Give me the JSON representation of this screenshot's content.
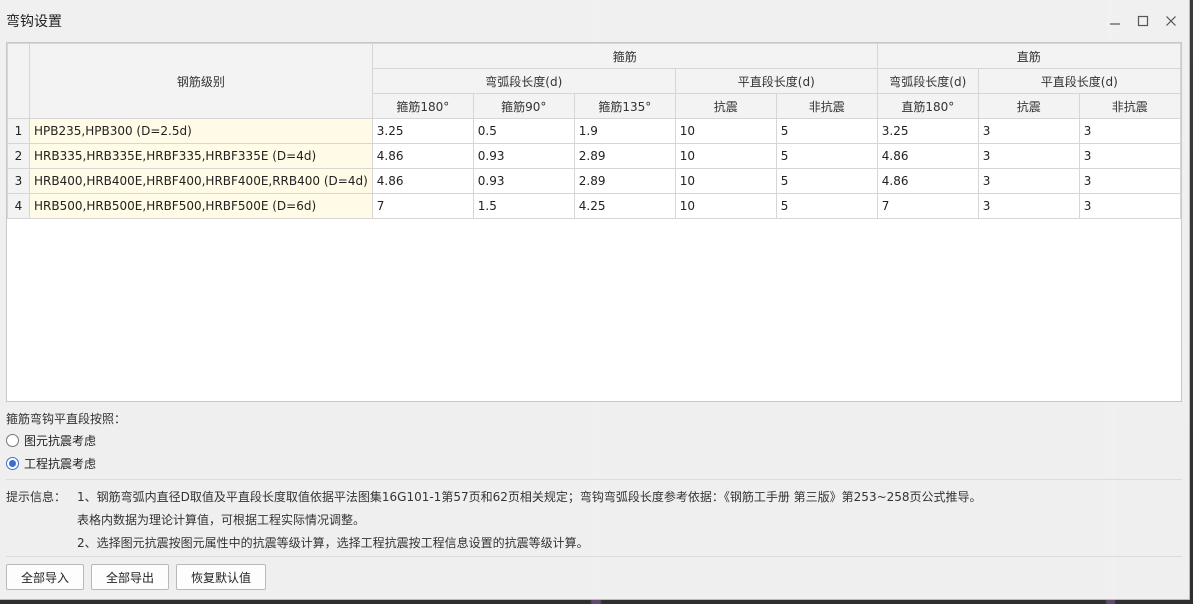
{
  "window": {
    "title": "弯钩设置",
    "minimize_label": "─",
    "maximize_label": "☐",
    "close_label": "✕"
  },
  "table": {
    "header_group": {
      "grade": "钢筋级别",
      "stirrup": "箍筋",
      "straight": "直筋"
    },
    "header_sub": {
      "stirrup_arc": "弯弧段长度(d)",
      "stirrup_flat": "平直段长度(d)",
      "straight_arc": "弯弧段长度(d)",
      "straight_flat": "平直段长度(d)"
    },
    "header_leaf": [
      "箍筋180°",
      "箍筋90°",
      "箍筋135°",
      "抗震",
      "非抗震",
      "直筋180°",
      "抗震",
      "非抗震"
    ],
    "rows": [
      {
        "num": "1",
        "grade": "HPB235,HPB300 (D=2.5d)",
        "cells": [
          "3.25",
          "0.5",
          "1.9",
          "10",
          "5",
          "3.25",
          "3",
          "3"
        ]
      },
      {
        "num": "2",
        "grade": "HRB335,HRB335E,HRBF335,HRBF335E (D=4d)",
        "cells": [
          "4.86",
          "0.93",
          "2.89",
          "10",
          "5",
          "4.86",
          "3",
          "3"
        ]
      },
      {
        "num": "3",
        "grade": "HRB400,HRB400E,HRBF400,HRBF400E,RRB400 (D=4d)",
        "cells": [
          "4.86",
          "0.93",
          "2.89",
          "10",
          "5",
          "4.86",
          "3",
          "3"
        ]
      },
      {
        "num": "4",
        "grade": "HRB500,HRB500E,HRBF500,HRBF500E (D=6d)",
        "cells": [
          "7",
          "1.5",
          "4.25",
          "10",
          "5",
          "7",
          "3",
          "3"
        ]
      }
    ]
  },
  "stirrup_option": {
    "label": "箍筋弯钩平直段按照：",
    "options": [
      {
        "label": "图元抗震考虑",
        "checked": false
      },
      {
        "label": "工程抗震考虑",
        "checked": true
      }
    ]
  },
  "hints": {
    "label": "提示信息：",
    "line1": "1、钢筋弯弧内直径D取值及平直段长度取值依据平法图集16G101-1第57页和62页相关规定；弯钩弯弧段长度参考依据：《钢筋工手册  第三版》第253~258页公式推导。",
    "line2": "表格内数据为理论计算值，可根据工程实际情况调整。",
    "line3": "2、选择图元抗震按图元属性中的抗震等级计算，选择工程抗震按工程信息设置的抗震等级计算。"
  },
  "buttons": {
    "import_all": "全部导入",
    "export_all": "全部导出",
    "restore_default": "恢复默认值"
  }
}
